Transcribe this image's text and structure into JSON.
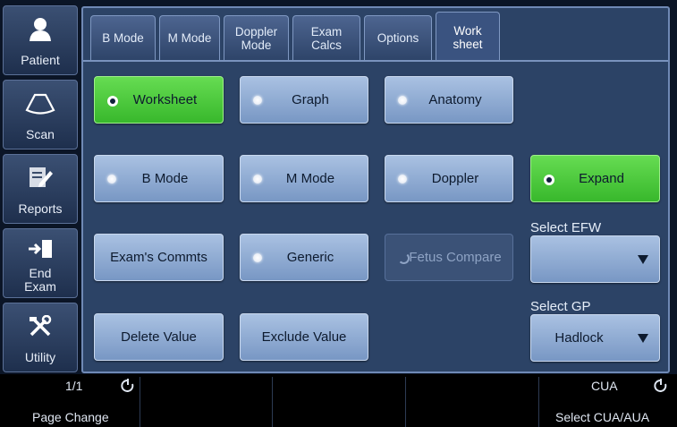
{
  "sidebar": {
    "items": [
      {
        "label": "Patient",
        "icon": "person-icon"
      },
      {
        "label": "Scan",
        "icon": "probe-icon"
      },
      {
        "label": "Reports",
        "icon": "report-edit-icon"
      },
      {
        "label": "End\nExam",
        "icon": "exit-door-icon"
      },
      {
        "label": "Utility",
        "icon": "tools-icon"
      }
    ]
  },
  "tabs": [
    {
      "label": "B Mode"
    },
    {
      "label": "M Mode"
    },
    {
      "label": "Doppler\nMode"
    },
    {
      "label": "Exam\nCalcs"
    },
    {
      "label": "Options"
    },
    {
      "label": "Work\nsheet",
      "active": true
    }
  ],
  "buttons": {
    "worksheet": "Worksheet",
    "graph": "Graph",
    "anatomy": "Anatomy",
    "b_mode": "B Mode",
    "m_mode": "M Mode",
    "doppler": "Doppler",
    "expand": "Expand",
    "exam_comments": "Exam's Commts",
    "generic": "Generic",
    "fetus_compare": "Fetus Compare",
    "delete_value": "Delete Value",
    "exclude_value": "Exclude Value"
  },
  "selects": {
    "efw": {
      "label": "Select EFW",
      "value": ""
    },
    "gp": {
      "label": "Select GP",
      "value": "Hadlock"
    }
  },
  "bottom_bar": {
    "page_counter": "1/1",
    "page_change_label": "Page Change",
    "cua_value": "CUA",
    "cua_label": "Select CUA/AUA"
  },
  "colors": {
    "active_green": "#4ccb3d",
    "button_blue": "#8ea9d2",
    "panel": "#2c4366"
  }
}
